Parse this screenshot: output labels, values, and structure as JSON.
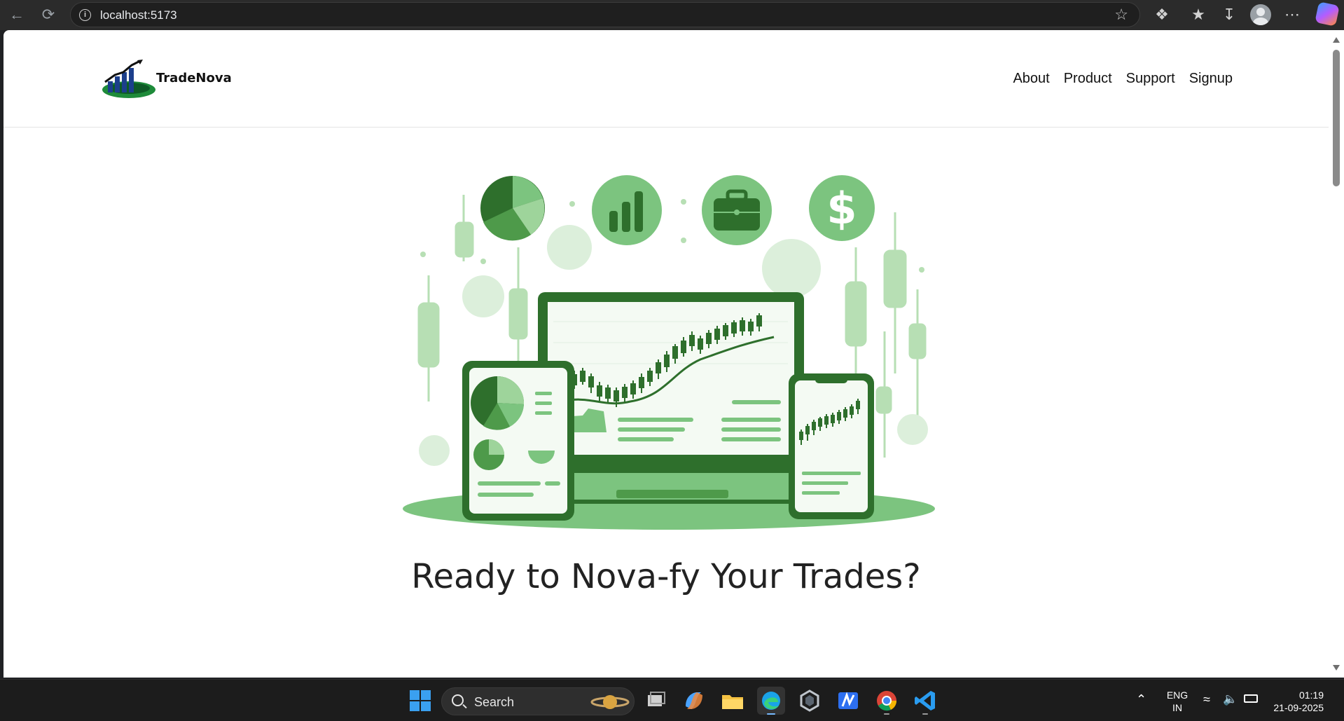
{
  "browser": {
    "url": "localhost:5173"
  },
  "site": {
    "brand": "TradeNova",
    "nav": [
      "About",
      "Product",
      "Support",
      "Signup"
    ],
    "headline": "Ready to Nova-fy Your Trades?"
  },
  "taskbar": {
    "search_label": "Search",
    "language_line1": "ENG",
    "language_line2": "IN",
    "time": "01:19",
    "date": "21-09-2025"
  },
  "colors": {
    "brand_green": "#2e7d32",
    "light_green": "#a5d6a7",
    "dark_green": "#1b5e20"
  }
}
